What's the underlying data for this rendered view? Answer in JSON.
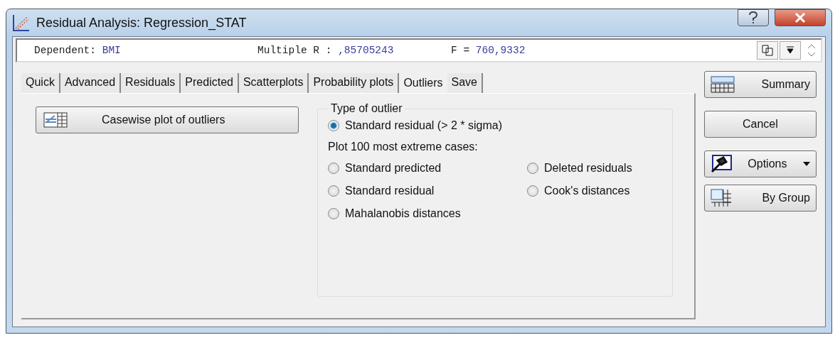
{
  "window": {
    "title": "Residual Analysis: Regression_STAT"
  },
  "info_bar": [
    {
      "label": "Dependent:",
      "value": "BMI"
    },
    {
      "label": "Multiple R :",
      "value": ",85705243"
    },
    {
      "label": "F =",
      "value": "760,9332"
    }
  ],
  "tabs": [
    {
      "label": "Quick",
      "selected": false
    },
    {
      "label": "Advanced",
      "selected": false
    },
    {
      "label": "Residuals",
      "selected": false
    },
    {
      "label": "Predicted",
      "selected": false
    },
    {
      "label": "Scatterplots",
      "selected": false
    },
    {
      "label": "Probability plots",
      "selected": false
    },
    {
      "label": "Outliers",
      "selected": true
    },
    {
      "label": "Save",
      "selected": false
    }
  ],
  "casewise_button": "Casewise plot of outliers",
  "outlier_group": {
    "title": "Type of outlier",
    "options": [
      {
        "label": "Standard residual (> 2 * sigma)",
        "selected": true
      }
    ],
    "extreme_label": "Plot 100 most extreme cases:",
    "extreme_options": [
      {
        "label": "Standard predicted",
        "selected": false
      },
      {
        "label": "Deleted residuals",
        "selected": false
      },
      {
        "label": "Standard residual",
        "selected": false
      },
      {
        "label": "Cook's distances",
        "selected": false
      },
      {
        "label": "Mahalanobis distances",
        "selected": false
      }
    ]
  },
  "side_buttons": [
    {
      "kind": "summary",
      "label": "Summary"
    },
    {
      "kind": "cancel",
      "label": "Cancel"
    },
    {
      "kind": "options",
      "label": "Options"
    },
    {
      "kind": "group",
      "label": "By Group"
    }
  ]
}
